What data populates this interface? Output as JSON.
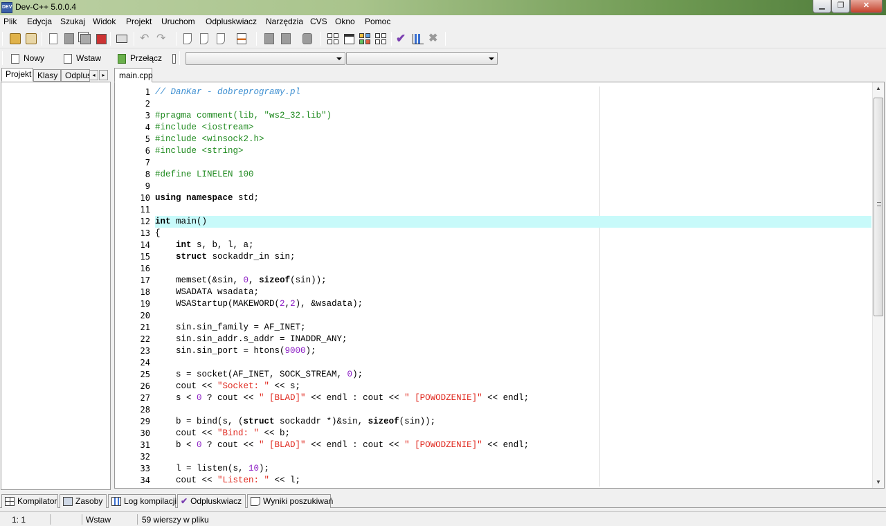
{
  "window": {
    "title": "Dev-C++ 5.0.0.4",
    "icon": "dev-cpp-app-icon",
    "icon_text": "DEV"
  },
  "menu": [
    "Plik",
    "Edycja",
    "Szukaj",
    "Widok",
    "Projekt",
    "Uruchom",
    "Odpluskwiacz",
    "Narzędzia",
    "CVS",
    "Okno",
    "Pomoc"
  ],
  "toolbar2": {
    "new_label": "Nowy",
    "insert_label": "Wstaw",
    "toggle_label": "Przełącz",
    "combo1_value": "",
    "combo2_value": ""
  },
  "left_panel": {
    "tabs": [
      "Projekt",
      "Klasy",
      "Odplus"
    ]
  },
  "editor": {
    "file_tab": "main.cpp",
    "highlighted_line": 12,
    "scroll_position": 0,
    "line_numbers": [
      "1",
      "2",
      "3",
      "4",
      "5",
      "6",
      "7",
      "8",
      "9",
      "10",
      "11",
      "12",
      "13",
      "14",
      "15",
      "16",
      "17",
      "18",
      "19",
      "20",
      "21",
      "22",
      "23",
      "24",
      "25",
      "26",
      "27",
      "28",
      "29",
      "30",
      "31",
      "32",
      "33",
      "34"
    ],
    "lines": [
      "// DanKar - dobreprogramy.pl",
      "",
      "#pragma comment(lib, \"ws2_32.lib\")",
      "#include <iostream>",
      "#include <winsock2.h>",
      "#include <string>",
      "",
      "#define LINELEN 100",
      "",
      "using namespace std;",
      "",
      "int main()",
      "{",
      "    int s, b, l, a;",
      "    struct sockaddr_in sin;",
      "",
      "    memset(&sin, 0, sizeof(sin));",
      "    WSADATA wsadata;",
      "    WSAStartup(MAKEWORD(2,2), &wsadata);",
      "",
      "    sin.sin_family = AF_INET;",
      "    sin.sin_addr.s_addr = INADDR_ANY;",
      "    sin.sin_port = htons(9000);",
      "",
      "    s = socket(AF_INET, SOCK_STREAM, 0);",
      "    cout << \"Socket: \" << s;",
      "    s < 0 ? cout << \" [BLAD]\" << endl : cout << \" [POWODZENIE]\" << endl;",
      "",
      "    b = bind(s, (struct sockaddr *)&sin, sizeof(sin));",
      "    cout << \"Bind: \" << b;",
      "    b < 0 ? cout << \" [BLAD]\" << endl : cout << \" [POWODZENIE]\" << endl;",
      "",
      "    l = listen(s, 10);",
      "    cout << \"Listen: \" << l;"
    ]
  },
  "bottom_tabs": [
    {
      "label": "Kompilator",
      "icon": "grid-icon"
    },
    {
      "label": "Zasoby",
      "icon": "resources-icon"
    },
    {
      "label": "Log kompilacji",
      "icon": "chart-icon"
    },
    {
      "label": "Odpluskwiacz",
      "icon": "check-icon"
    },
    {
      "label": "Wyniki poszukiwań",
      "icon": "search-icon"
    }
  ],
  "status": {
    "position": "1: 1",
    "mode": "Wstaw",
    "info": "59 wierszy w pliku"
  },
  "colors": {
    "line_highlight": "#c8fafa",
    "comment": "#3d8fd1",
    "preprocessor": "#1f8a1f",
    "string": "#e0281e",
    "number": "#8a1ac4",
    "titlebar_end": "#4d7a39"
  }
}
